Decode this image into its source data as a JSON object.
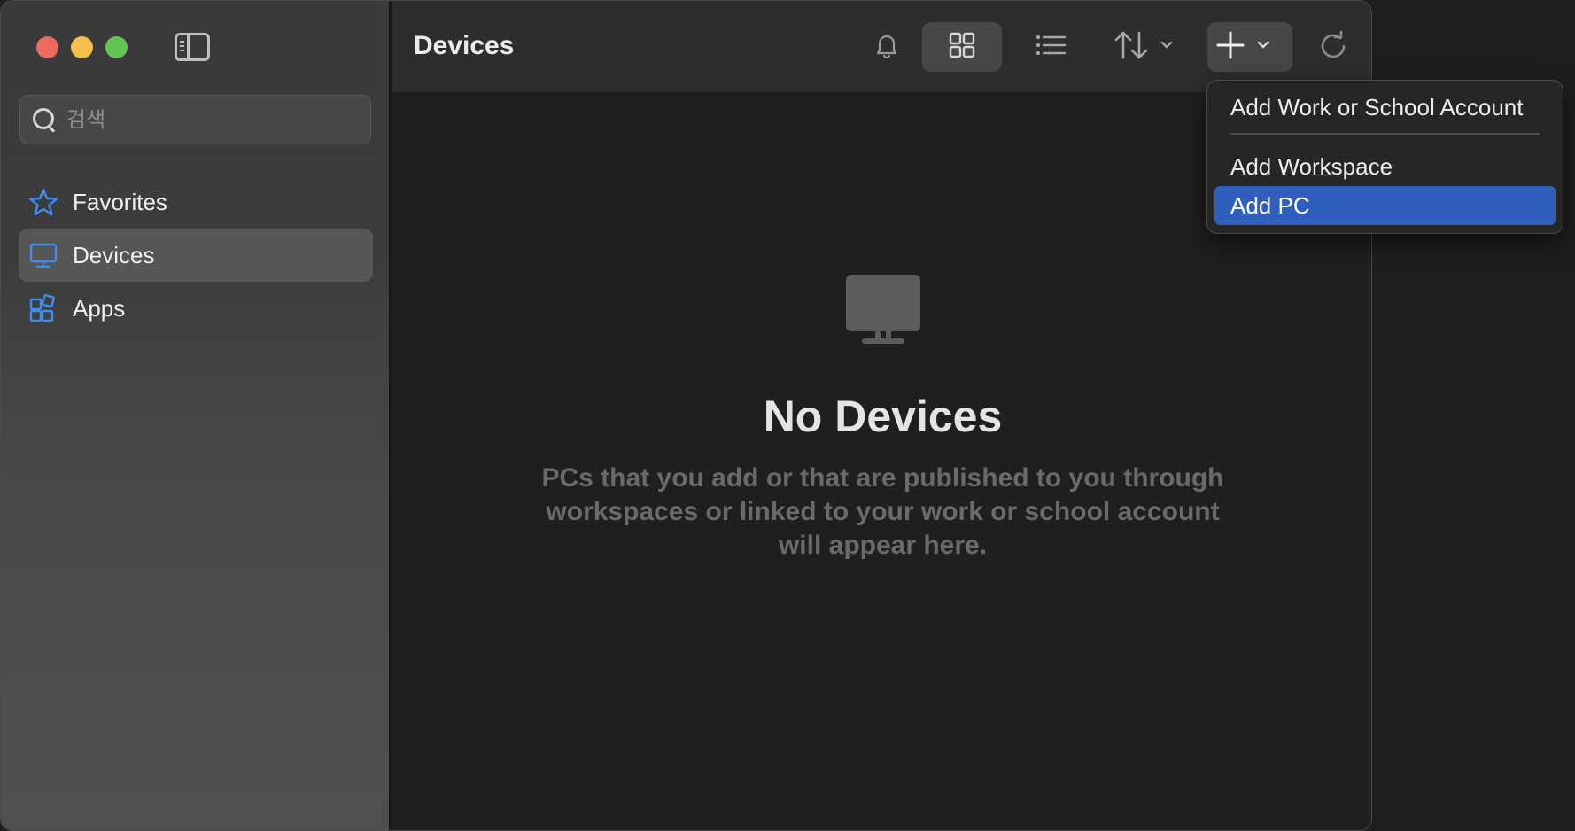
{
  "window": {
    "title": "Devices"
  },
  "sidebar": {
    "search_placeholder": "검색",
    "items": [
      {
        "label": "Favorites",
        "icon": "star-icon",
        "active": false
      },
      {
        "label": "Devices",
        "icon": "monitor-icon",
        "active": true
      },
      {
        "label": "Apps",
        "icon": "apps-grid-icon",
        "active": false
      }
    ]
  },
  "toolbar": {
    "title": "Devices",
    "buttons": [
      {
        "name": "bell-icon"
      },
      {
        "name": "grid-view-icon",
        "active": true
      },
      {
        "name": "list-view-icon"
      },
      {
        "name": "sort-icon"
      },
      {
        "name": "add-icon"
      },
      {
        "name": "refresh-icon"
      }
    ]
  },
  "empty_state": {
    "title": "No Devices",
    "description": "PCs that you add or that are published to you through workspaces or linked to your work or school account will appear here."
  },
  "add_menu": {
    "items": [
      {
        "label": "Add Work or School Account"
      },
      {
        "label": "Add Workspace"
      },
      {
        "label": "Add PC",
        "selected": true
      }
    ]
  },
  "colors": {
    "accent": "#2f5fbd",
    "sidebar_icon_blue": "#3d8ef0",
    "traffic_red": "#ed6a5e",
    "traffic_yellow": "#f5bf4f",
    "traffic_green": "#61c554"
  }
}
